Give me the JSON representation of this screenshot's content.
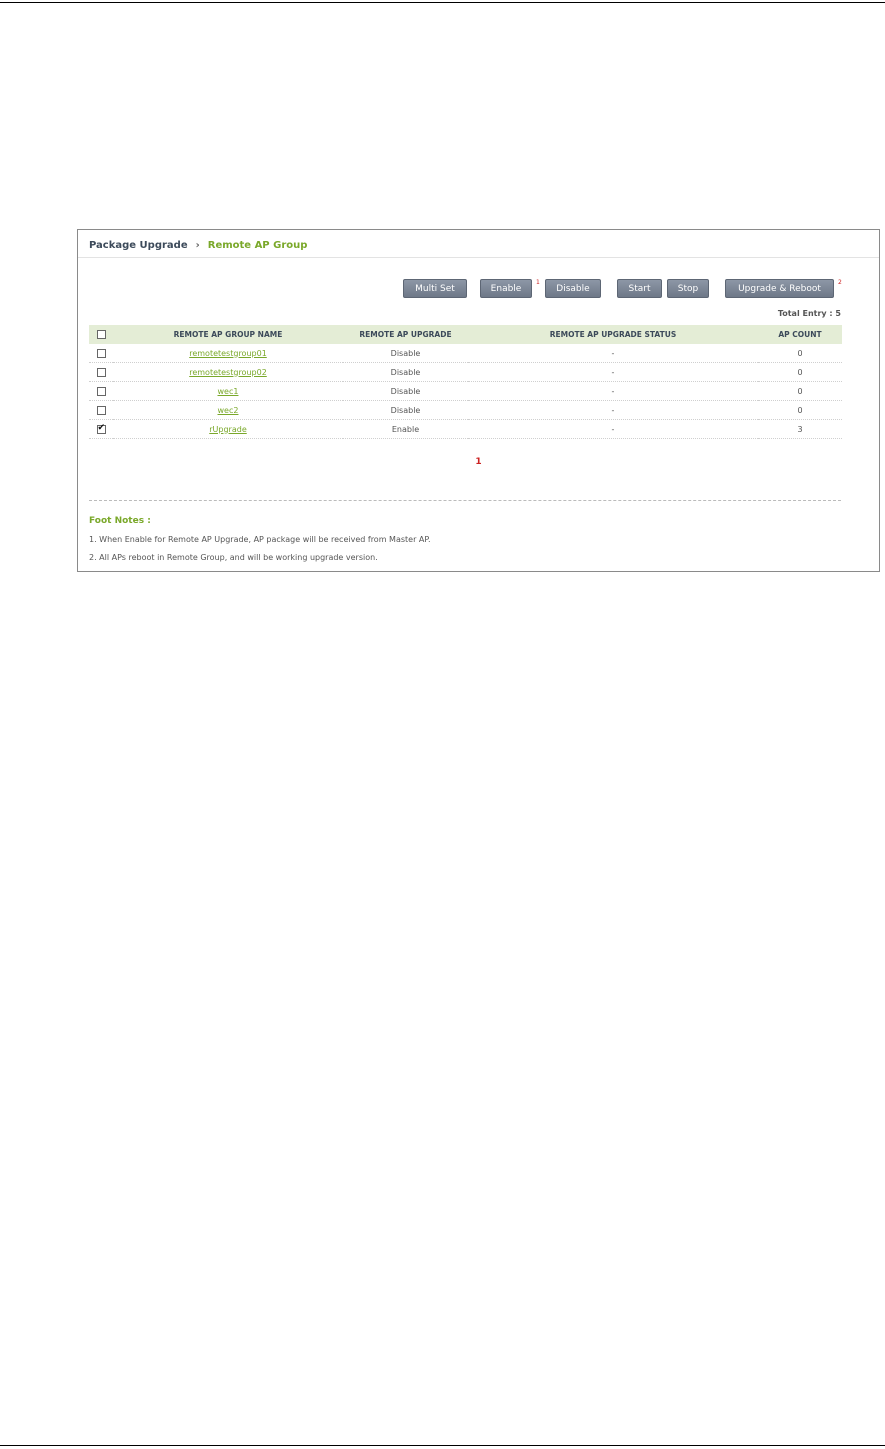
{
  "breadcrumb": {
    "parent": "Package Upgrade",
    "separator": "›",
    "current": "Remote AP Group"
  },
  "toolbar": {
    "multi_set": "Multi Set",
    "enable": "Enable",
    "enable_mark": "1",
    "disable": "Disable",
    "start": "Start",
    "stop": "Stop",
    "upgrade_reboot": "Upgrade & Reboot",
    "upgrade_reboot_mark": "2"
  },
  "total_entry": {
    "label": "Total Entry :",
    "value": "5"
  },
  "table": {
    "headers": [
      "REMOTE AP GROUP NAME",
      "REMOTE AP UPGRADE",
      "REMOTE AP UPGRADE STATUS",
      "AP COUNT"
    ],
    "rows": [
      {
        "checked": false,
        "name": "remotetestgroup01",
        "upgrade": "Disable",
        "status": "-",
        "count": "0"
      },
      {
        "checked": false,
        "name": "remotetestgroup02",
        "upgrade": "Disable",
        "status": "-",
        "count": "0"
      },
      {
        "checked": false,
        "name": "wec1",
        "upgrade": "Disable",
        "status": "-",
        "count": "0"
      },
      {
        "checked": false,
        "name": "wec2",
        "upgrade": "Disable",
        "status": "-",
        "count": "0"
      },
      {
        "checked": true,
        "name": "rUpgrade",
        "upgrade": "Enable",
        "status": "-",
        "count": "3"
      }
    ]
  },
  "pagination": {
    "current_page": "1"
  },
  "footnotes": {
    "title": "Foot Notes :",
    "notes": [
      "1. When Enable for Remote AP Upgrade, AP package will be received from Master AP.",
      "2. All APs reboot in Remote Group, and will be working upgrade version."
    ]
  },
  "colors": {
    "accent_green": "#7aa82a",
    "header_bg": "#e4edd6",
    "button_bg": "#7a8494",
    "mark_red": "#cc2222"
  }
}
